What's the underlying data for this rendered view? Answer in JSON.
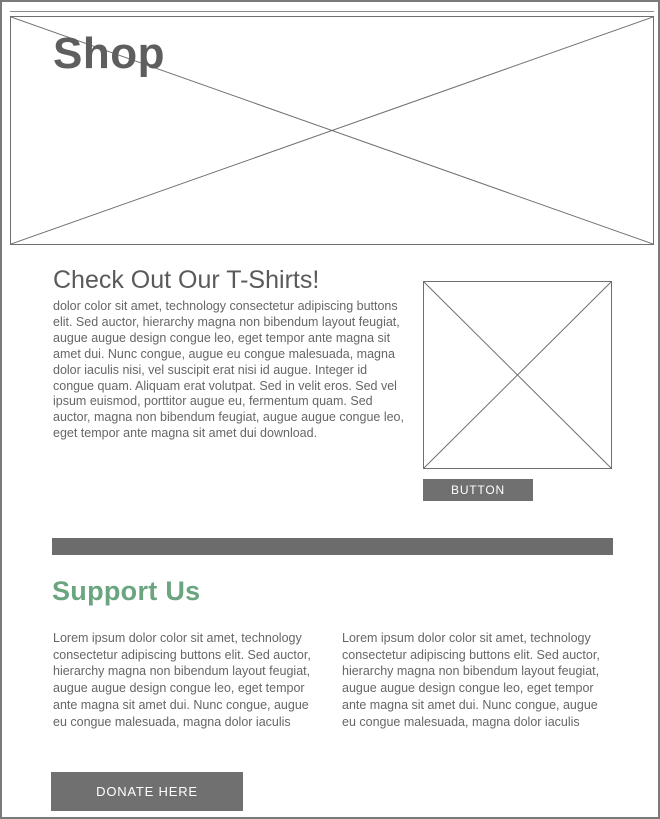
{
  "hero": {
    "title": "Shop"
  },
  "tshirts": {
    "heading": "Check Out Our T-Shirts!",
    "body": "dolor color sit amet, technology consectetur adipiscing buttons elit. Sed auctor, hierarchy magna non bibendum layout feugiat, augue augue design congue leo, eget tempor ante magna sit amet dui. Nunc congue, augue eu congue malesuada, magna dolor iaculis nisi, vel suscipit erat nisi id augue. Integer id congue quam. Aliquam erat volutpat. Sed in velit eros. Sed vel ipsum euismod, porttitor augue eu, fermentum quam. Sed auctor, magna non bibendum feugiat, augue augue congue leo, eget tempor ante magna sit amet dui download.",
    "button_label": "BUTTON"
  },
  "support": {
    "heading": "Support Us",
    "col_left": "Lorem ipsum dolor color sit amet, technology consectetur adipiscing buttons elit. Sed auctor, hierarchy magna non bibendum layout feugiat, augue augue design congue leo, eget tempor ante magna sit amet dui. Nunc congue, augue eu congue malesuada, magna dolor iaculis",
    "col_right": "Lorem ipsum dolor color sit amet, technology consectetur adipiscing buttons elit. Sed auctor, hierarchy magna non bibendum layout feugiat, augue augue design congue leo, eget tempor ante magna sit amet dui. Nunc congue, augue eu congue malesuada, magna dolor iaculis",
    "donate_label": "DONATE HERE"
  },
  "colors": {
    "accent_green": "#6aa57f",
    "button_gray": "#707070",
    "wire_gray": "#6f6f6f"
  }
}
